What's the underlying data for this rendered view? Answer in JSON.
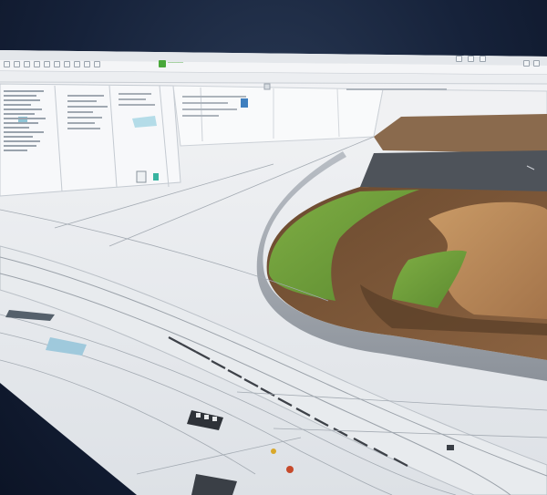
{
  "window": {
    "document_tab_label": "———",
    "accent": "#49a83a"
  },
  "toolbar": {
    "icons": [
      "select-icon",
      "move-icon",
      "rotate-icon",
      "scale-icon",
      "layers-icon",
      "grid-icon",
      "measure-icon",
      "terrain-icon",
      "camera-icon",
      "render-icon"
    ]
  },
  "colors": {
    "grass": "#6e9e3a",
    "soil": "#7a5a3c",
    "sand": "#b08457",
    "surface": "#eef0f2",
    "frame": "#c9ced4",
    "dark_bg": "#16223a"
  }
}
